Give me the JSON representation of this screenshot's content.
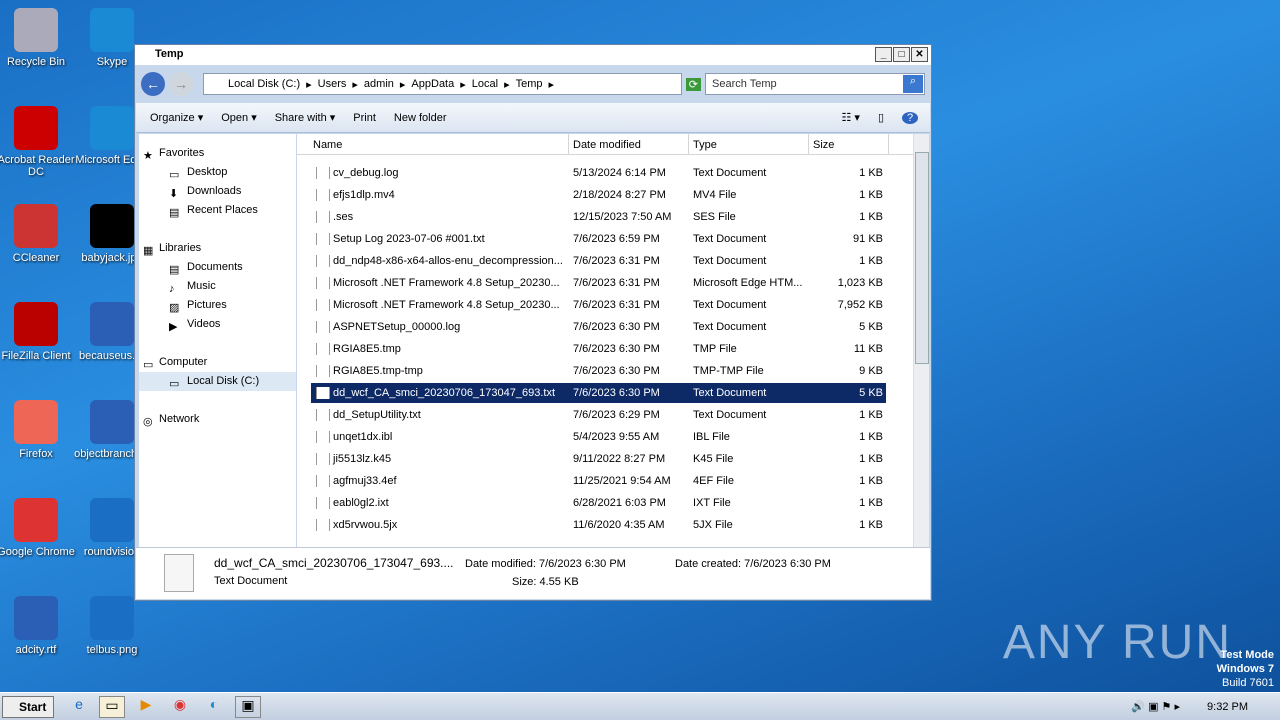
{
  "desktop": [
    "Recycle Bin",
    "Skype",
    "Acrobat Reader DC",
    "Microsoft Edge",
    "CCleaner",
    "babyjack.jpg",
    "FileZilla Client",
    "becauseus.rtf",
    "Firefox",
    "objectbranch.rtf",
    "Google Chrome",
    "roundvision",
    "adcity.rtf",
    "telbus.png"
  ],
  "window": {
    "title": "Temp"
  },
  "address": {
    "crumbs": [
      "Local Disk (C:)",
      "Users",
      "admin",
      "AppData",
      "Local",
      "Temp"
    ],
    "search_placeholder": "Search Temp"
  },
  "toolbar": {
    "organize": "Organize",
    "open": "Open",
    "share": "Share with",
    "print": "Print",
    "new_folder": "New folder"
  },
  "nav": [
    "Favorites",
    "Desktop",
    "Downloads",
    "Recent Places",
    "Libraries",
    "Documents",
    "Music",
    "Pictures",
    "Videos",
    "Computer",
    "Local Disk (C:)",
    "Network"
  ],
  "columns": [
    "Name",
    "Date modified",
    "Type",
    "Size"
  ],
  "files": [
    [
      "cv_debug.log",
      "5/13/2024 6:14 PM",
      "Text Document",
      "1 KB"
    ],
    [
      "efjs1dlp.mv4",
      "2/18/2024 8:27 PM",
      "MV4 File",
      "1 KB"
    ],
    [
      ".ses",
      "12/15/2023 7:50 AM",
      "SES File",
      "1 KB"
    ],
    [
      "Setup Log 2023-07-06 #001.txt",
      "7/6/2023 6:59 PM",
      "Text Document",
      "91 KB"
    ],
    [
      "dd_ndp48-x86-x64-allos-enu_decompression...",
      "7/6/2023 6:31 PM",
      "Text Document",
      "1 KB"
    ],
    [
      "Microsoft .NET Framework 4.8 Setup_20230...",
      "7/6/2023 6:31 PM",
      "Microsoft Edge HTM...",
      "1,023 KB"
    ],
    [
      "Microsoft .NET Framework 4.8 Setup_20230...",
      "7/6/2023 6:31 PM",
      "Text Document",
      "7,952 KB"
    ],
    [
      "ASPNETSetup_00000.log",
      "7/6/2023 6:30 PM",
      "Text Document",
      "5 KB"
    ],
    [
      "RGIA8E5.tmp",
      "7/6/2023 6:30 PM",
      "TMP File",
      "11 KB"
    ],
    [
      "RGIA8E5.tmp-tmp",
      "7/6/2023 6:30 PM",
      "TMP-TMP File",
      "9 KB"
    ],
    [
      "dd_wcf_CA_smci_20230706_173047_693.txt",
      "7/6/2023 6:30 PM",
      "Text Document",
      "5 KB"
    ],
    [
      "dd_SetupUtility.txt",
      "7/6/2023 6:29 PM",
      "Text Document",
      "1 KB"
    ],
    [
      "unqet1dx.ibl",
      "5/4/2023 9:55 AM",
      "IBL File",
      "1 KB"
    ],
    [
      "ji5513lz.k45",
      "9/11/2022 8:27 PM",
      "K45 File",
      "1 KB"
    ],
    [
      "agfmuj33.4ef",
      "11/25/2021 9:54 AM",
      "4EF File",
      "1 KB"
    ],
    [
      "eabl0gl2.ixt",
      "6/28/2021 6:03 PM",
      "IXT File",
      "1 KB"
    ],
    [
      "xd5rvwou.5jx",
      "11/6/2020 4:35 AM",
      "5JX File",
      "1 KB"
    ]
  ],
  "selected_index": 10,
  "details": {
    "name": "dd_wcf_CA_smci_20230706_173047_693....",
    "type": "Text Document",
    "modified": "Date modified: 7/6/2023 6:30 PM",
    "size": "Size: 4.55 KB",
    "created": "Date created: 7/6/2023 6:30 PM"
  },
  "taskbar": {
    "start": "Start",
    "clock": "9:32 PM"
  },
  "watermark": "ANY RUN",
  "testmode": [
    "Test Mode",
    "Windows 7",
    "Build 7601"
  ]
}
